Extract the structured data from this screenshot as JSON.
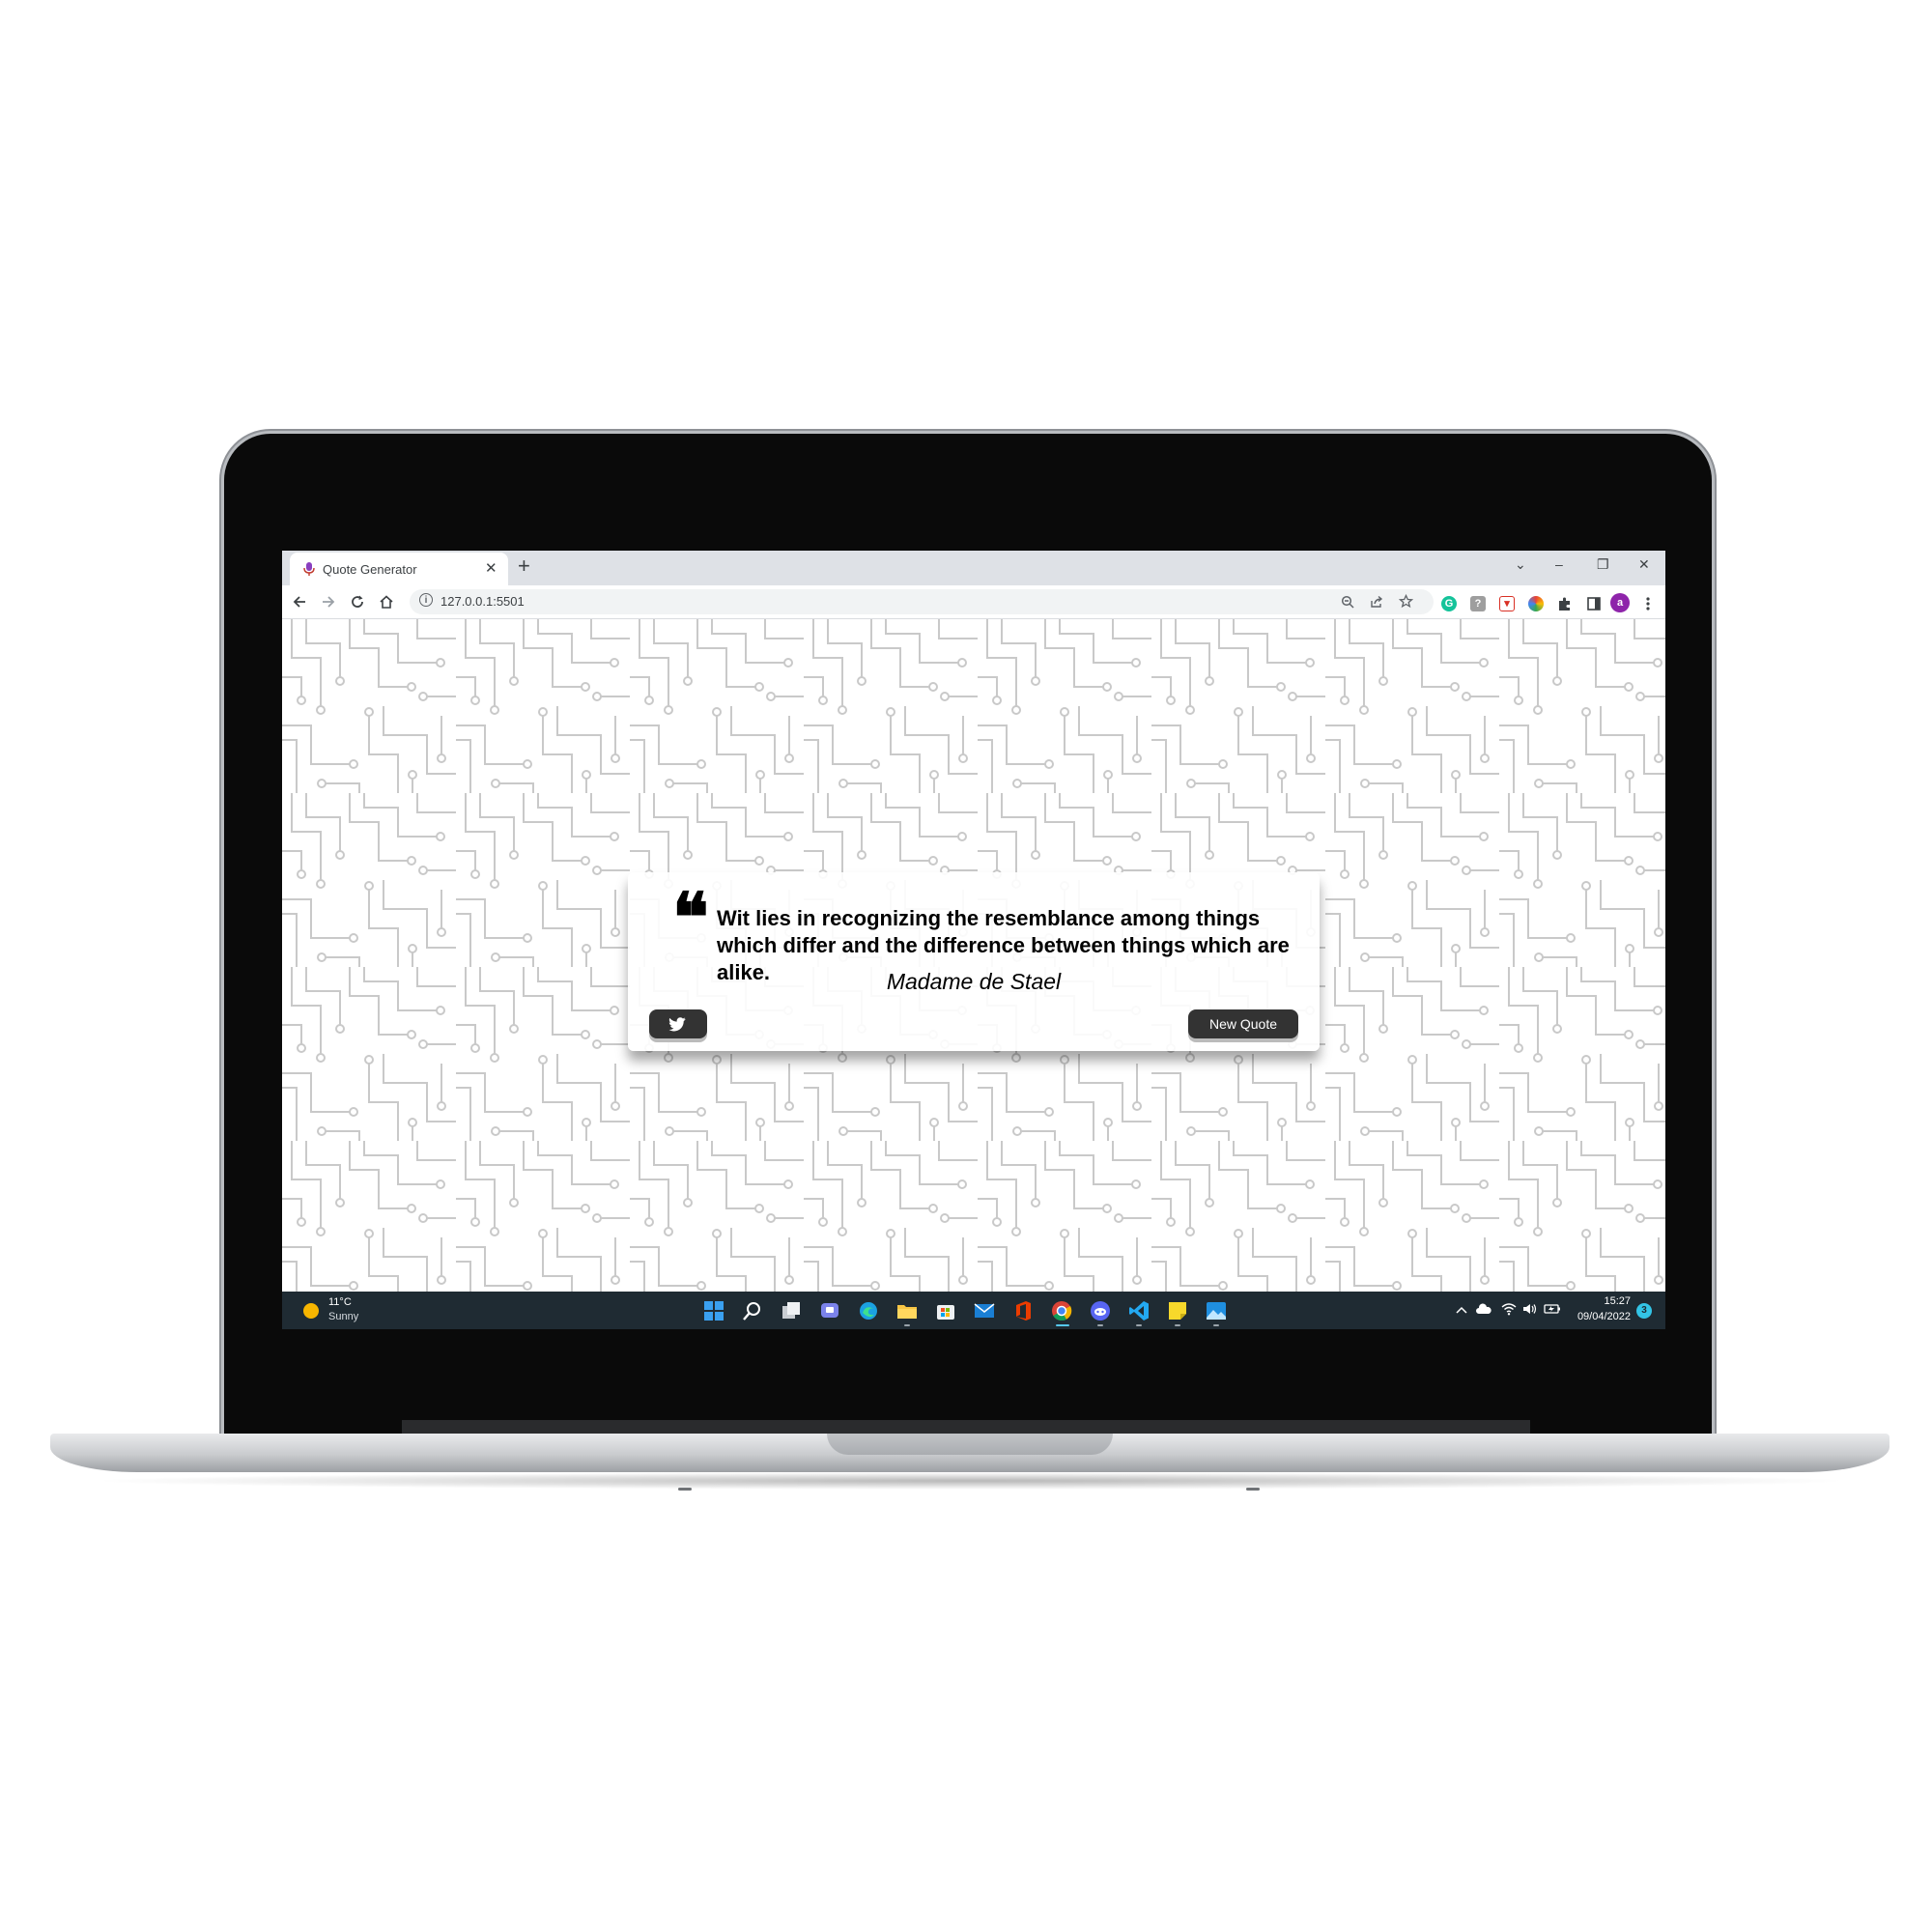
{
  "browser": {
    "tab_title": "Quote Generator",
    "tab_close": "✕",
    "new_tab": "+",
    "url": "127.0.0.1:5501",
    "window_controls": {
      "tab_search": "⌄",
      "minimize": "–",
      "restore": "❐",
      "close": "✕"
    },
    "profile_initial": "a"
  },
  "quote": {
    "mark": "❝",
    "text": "Wit lies in recognizing the resemblance among things which differ and the difference between things which are alike.",
    "author": "Madame de Stael",
    "new_quote_label": "New Quote"
  },
  "taskbar": {
    "weather_temp": "11°C",
    "weather_desc": "Sunny",
    "time": "15:27",
    "date": "09/04/2022",
    "notification_count": "3"
  },
  "colors": {
    "screen_bezel": "#0a0a0a",
    "titlebar": "#dee1e6",
    "button_bg": "#333333",
    "taskbar": "#1f2b33",
    "circuit_lines": "#c9c9c9"
  },
  "icons": {
    "back": "arrow-left-icon",
    "forward": "arrow-right-icon",
    "reload": "reload-icon",
    "home": "home-icon",
    "twitter": "twitter-icon"
  }
}
